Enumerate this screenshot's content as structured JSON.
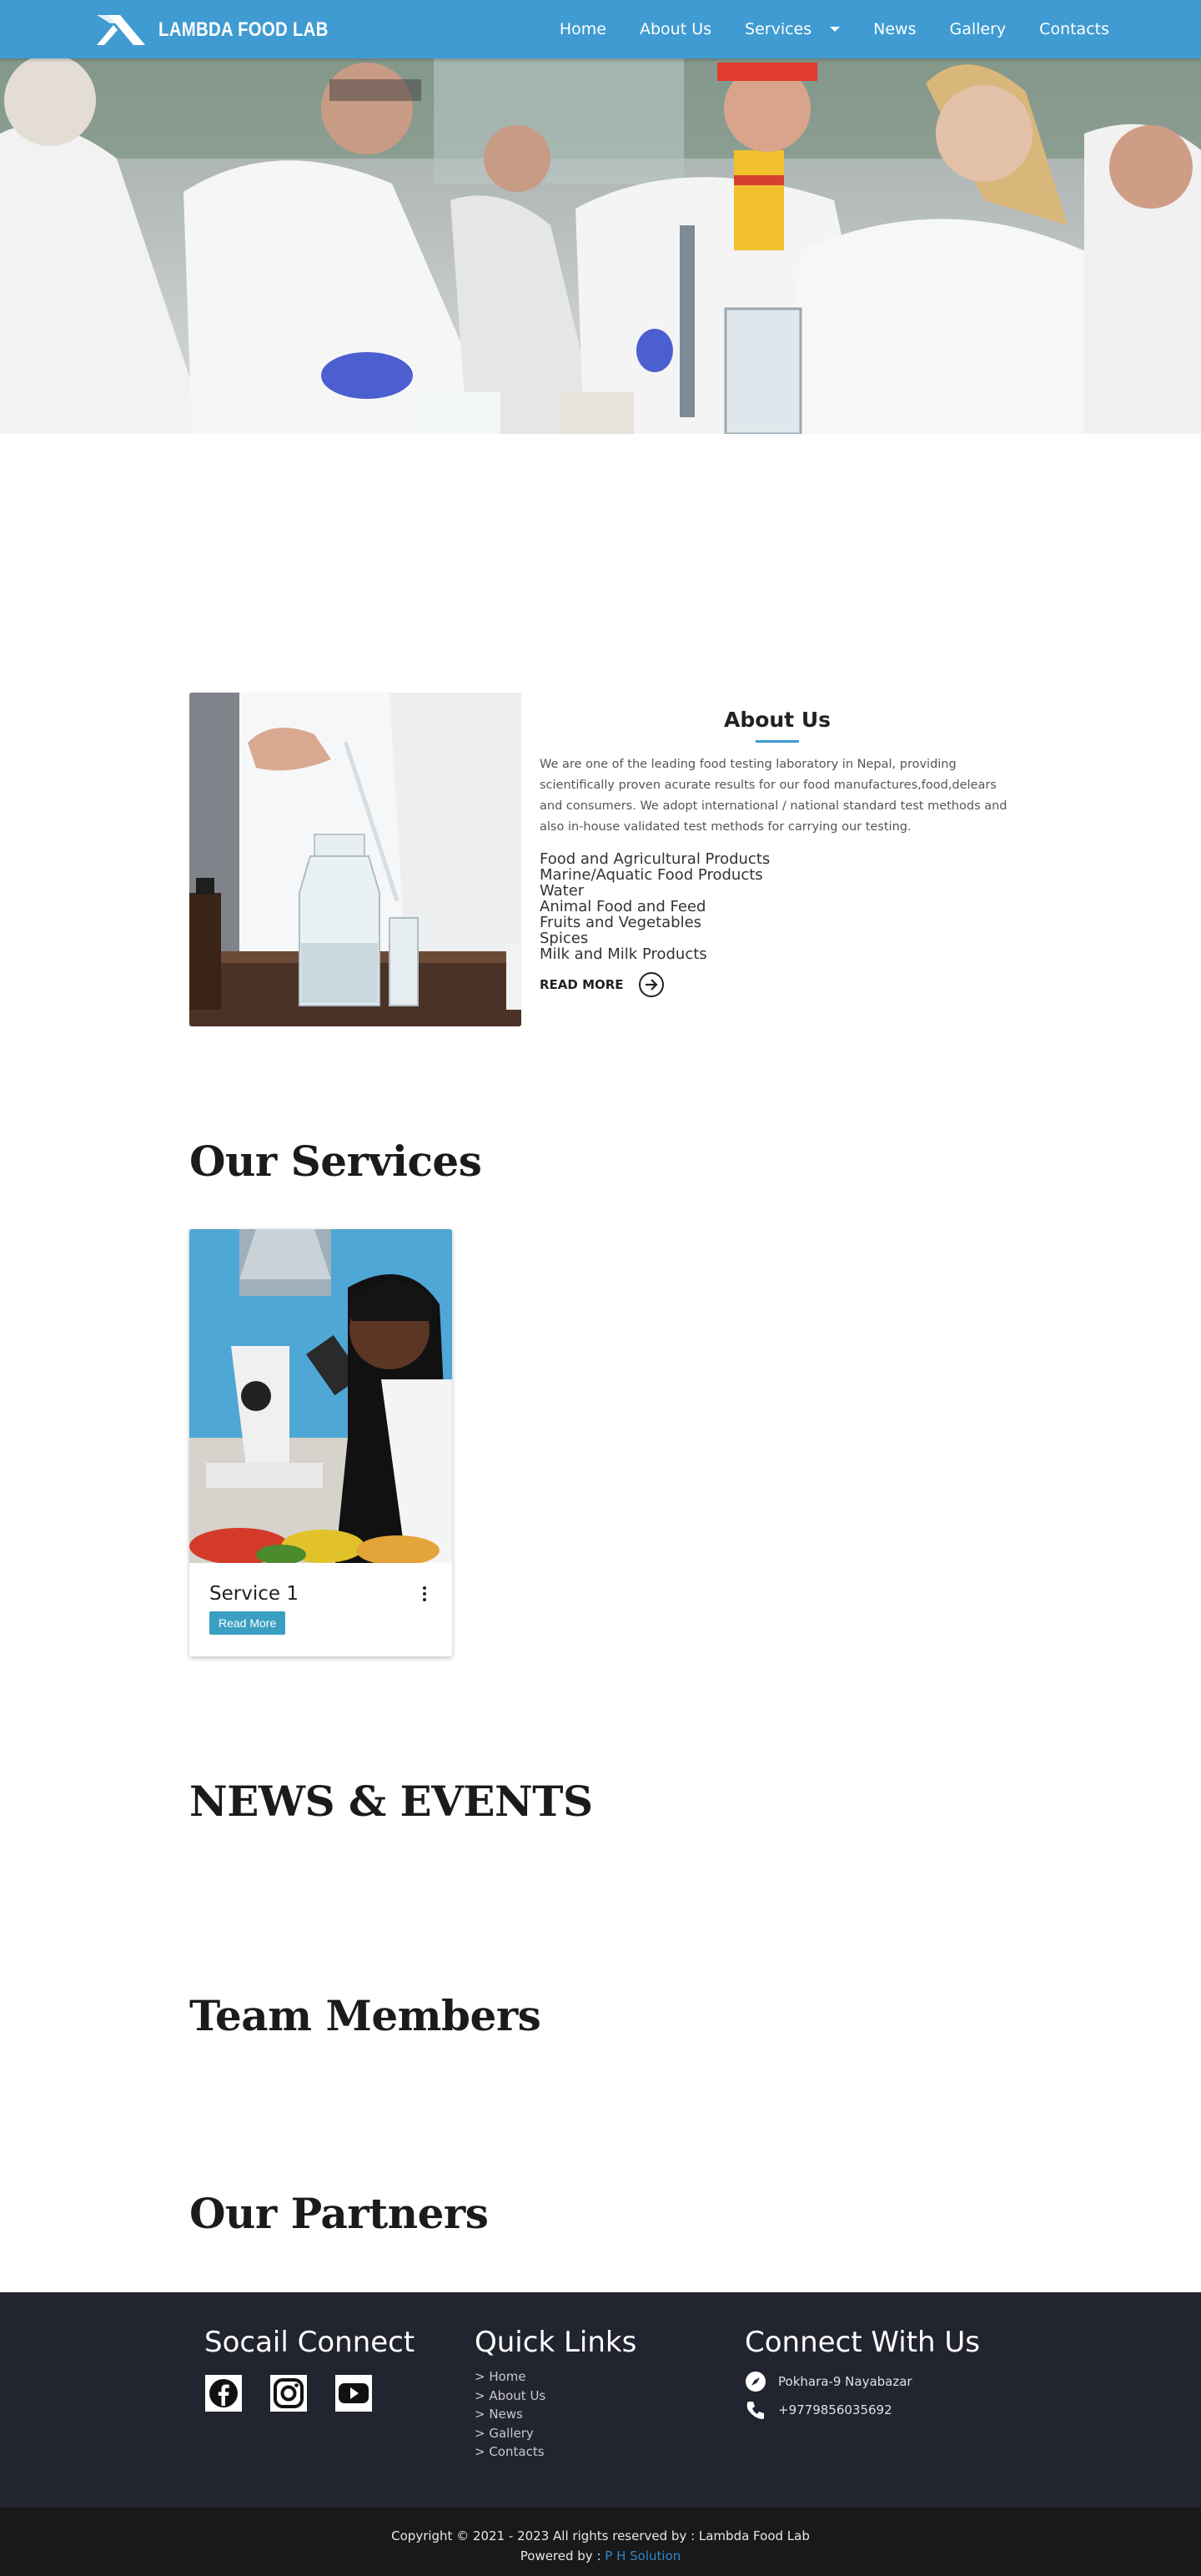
{
  "brand": {
    "name": "LAMBDA FOOD LAB"
  },
  "nav": {
    "items": [
      {
        "label": "Home"
      },
      {
        "label": "About Us"
      },
      {
        "label": "Services"
      },
      {
        "label": "News"
      },
      {
        "label": "Gallery"
      },
      {
        "label": "Contacts"
      }
    ]
  },
  "about": {
    "title": "About Us",
    "paragraph": "We are one of the leading food testing laboratory in Nepal, providing scientifically proven acurate results for our food manufactures,food,delears and consumers. We adopt international / national standard test methods and also in-house validated test methods for carrying our testing.",
    "products": [
      "Food and Agricultural Products",
      "Marine/Aquatic Food Products",
      "Water",
      "Animal Food and Feed",
      "Fruits and Vegetables",
      "Spices",
      "Milk and Milk Products"
    ],
    "read_more": "READ MORE"
  },
  "services": {
    "title": "Our Services",
    "cards": [
      {
        "title": "Service 1",
        "button": "Read More"
      }
    ]
  },
  "news": {
    "title": "NEWS & EVENTS"
  },
  "team": {
    "title": "Team Members"
  },
  "partners": {
    "title": "Our Partners"
  },
  "footer": {
    "social": {
      "title": "Socail Connect",
      "icons": [
        "facebook-icon",
        "instagram-icon",
        "youtube-icon"
      ]
    },
    "quick_links": {
      "title": "Quick Links",
      "items": [
        "> Home",
        "> About Us",
        "> News",
        "> Gallery",
        "> Contacts"
      ]
    },
    "connect": {
      "title": "Connect With Us",
      "address": "Pokhara-9 Nayabazar",
      "phone": "+9779856035692"
    },
    "copyright": "Copyright © 2021 - 2023 All rights reserved by : Lambda Food Lab",
    "powered_label": "Powered by : ",
    "powered_link": "P H Solution"
  },
  "colors": {
    "primary": "#3f9bd2",
    "footer_bg": "#222430",
    "bottom_bar": "#191919",
    "button": "#3a9fc2"
  }
}
